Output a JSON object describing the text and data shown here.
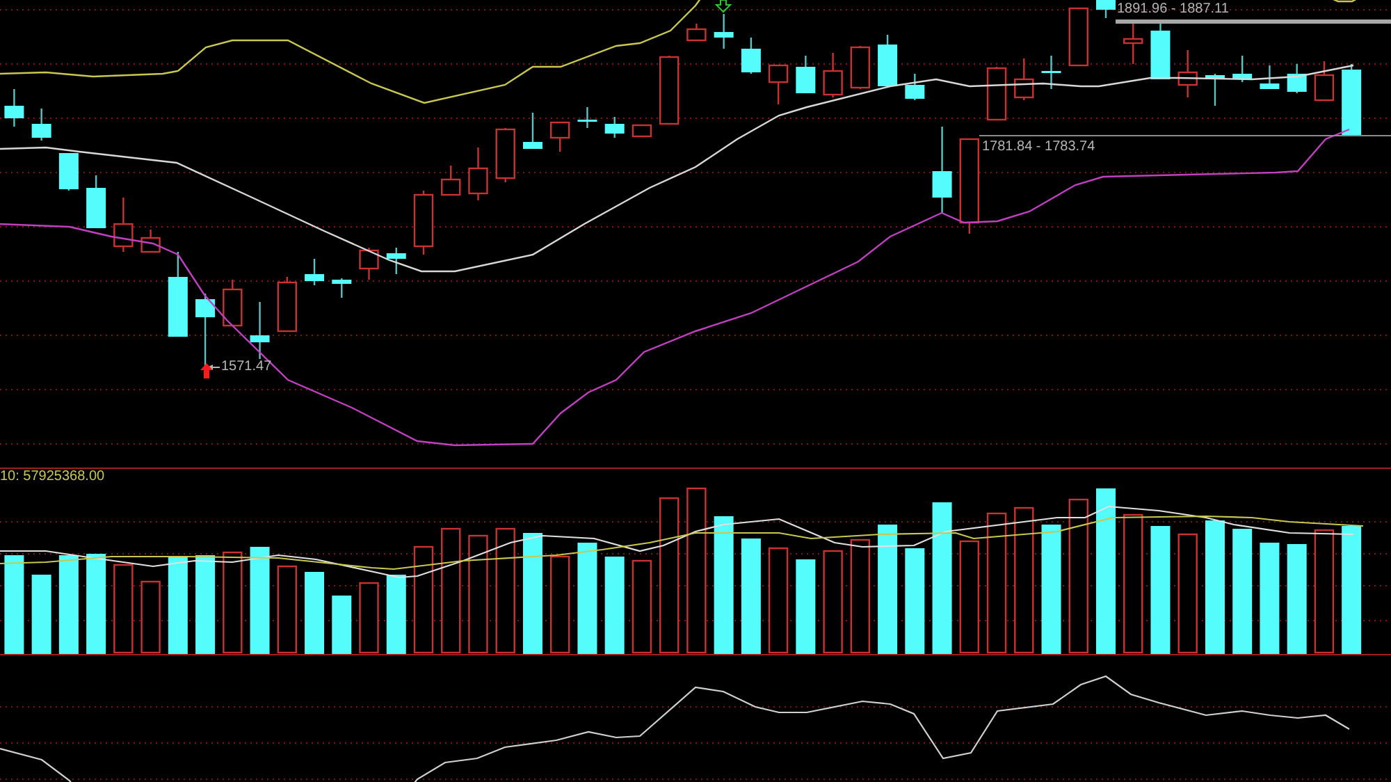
{
  "price_chart": {
    "low_label": "1571.47",
    "range_labels": [
      "1891.96 - 1887.11",
      "1781.84 - 1783.74"
    ]
  },
  "volume_chart": {
    "legend": "10: 57925368.00"
  }
}
